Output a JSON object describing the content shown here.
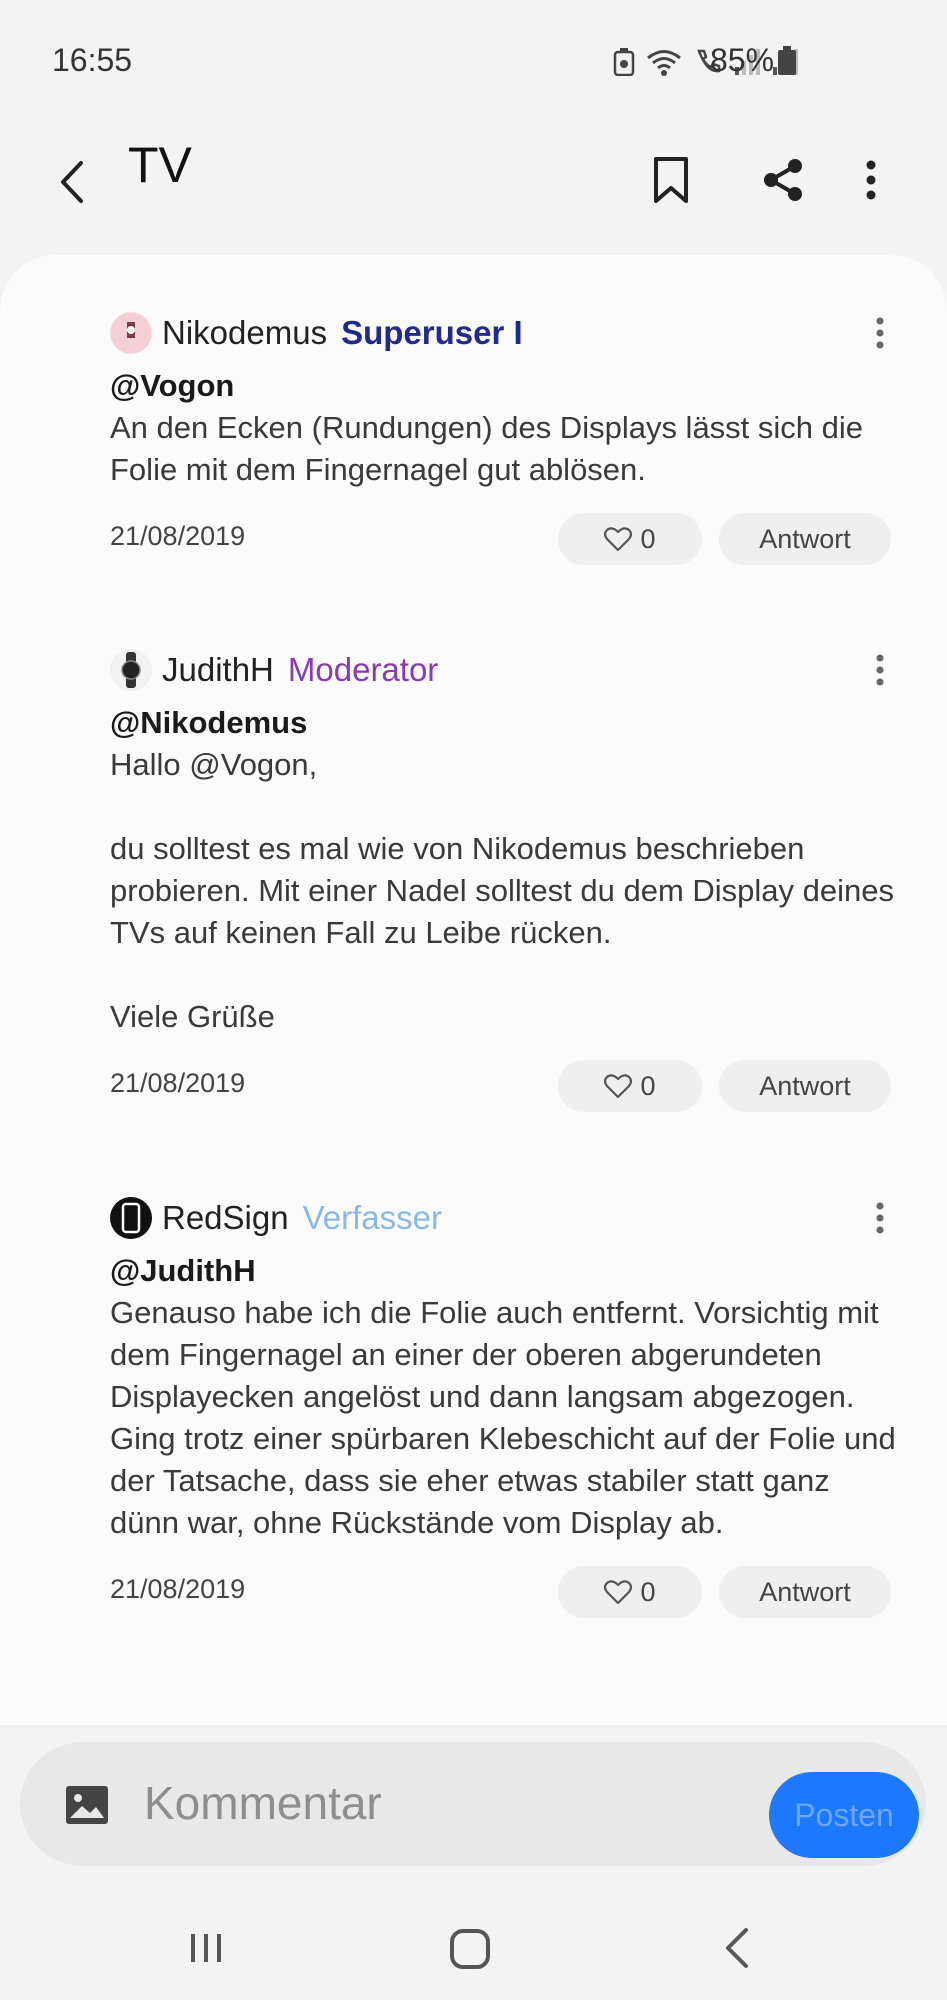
{
  "status_bar": {
    "time": "16:55",
    "battery": "85%"
  },
  "header": {
    "title": "TV"
  },
  "comments": [
    {
      "author": "Nikodemus",
      "role": "Superuser I",
      "role_color": "#1f2a8c",
      "mention": "@Vogon",
      "text": "An den Ecken (Rundungen) des Displays lässt sich die Folie mit dem Fingernagel gut ablösen.",
      "date": "21/08/2019",
      "likes": "0",
      "reply_label": "Antwort"
    },
    {
      "author": "JudithH",
      "role": "Moderator",
      "role_color": "#8a3ab8",
      "mention": "@Nikodemus",
      "text": "Hallo @Vogon,\n\ndu solltest es mal wie von Nikodemus beschrieben probieren. Mit einer Nadel solltest du dem Display deines TVs auf keinen Fall zu Leibe rücken.\n\nViele Grüße",
      "date": "21/08/2019",
      "likes": "0",
      "reply_label": "Antwort"
    },
    {
      "author": "RedSign",
      "role": "Verfasser",
      "role_color": "#8cb8e8",
      "mention": "@JudithH",
      "text": "Genauso habe ich die Folie auch entfernt. Vorsichtig mit dem Fingernagel an einer der oberen abgerundeten Displayecken angelöst und dann langsam abgezogen. Ging trotz einer spürbaren Klebeschicht auf der Folie und der Tatsache, dass sie eher etwas stabiler statt ganz dünn war, ohne Rückstände vom Display ab.",
      "date": "21/08/2019",
      "likes": "0",
      "reply_label": "Antwort"
    }
  ],
  "comment_box": {
    "placeholder": "Kommentar",
    "post_label": "Posten"
  },
  "colors": {
    "accent": "#1e78ff",
    "page_bg": "#f3f3f3",
    "card_bg": "#fbfbfb"
  }
}
